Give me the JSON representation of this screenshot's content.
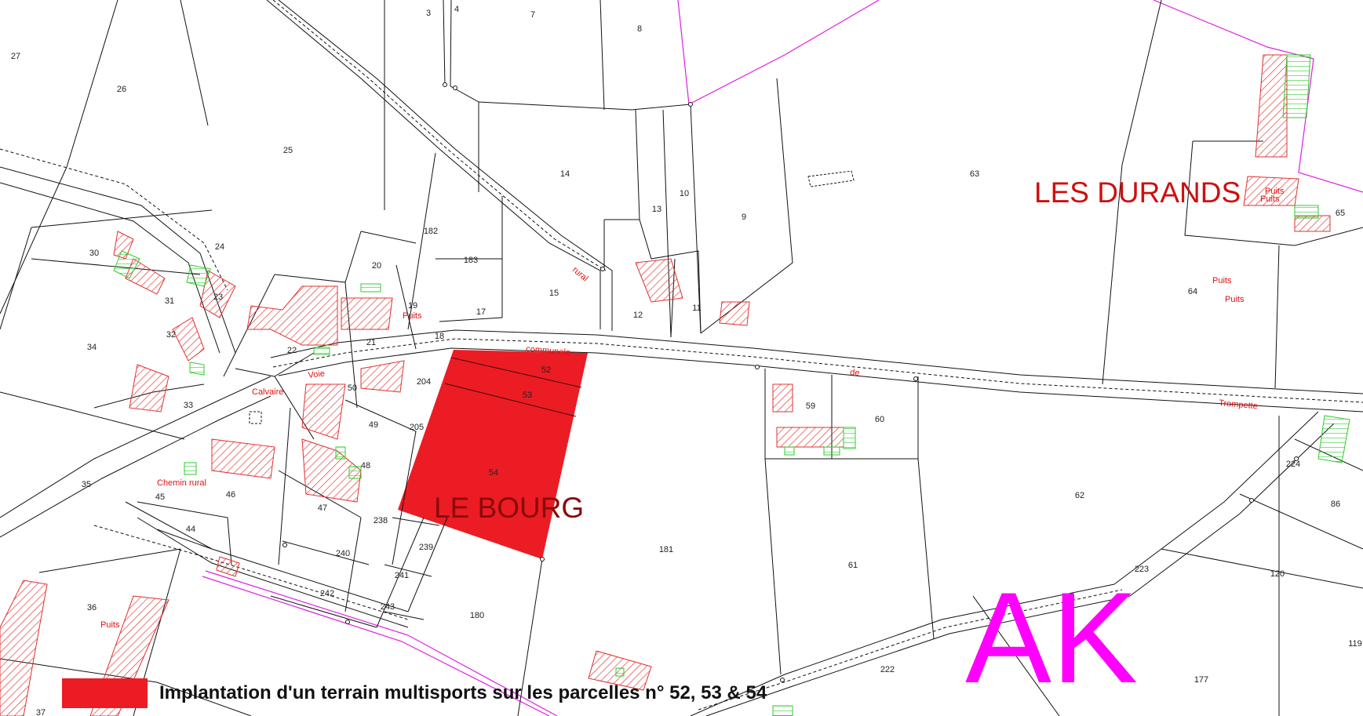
{
  "map": {
    "place_names": {
      "les_durands": "LES DURANDS",
      "le_bourg": "LE BOURG"
    },
    "section_label": "AK",
    "parcels": [
      "3",
      "4",
      "7",
      "8",
      "27",
      "26",
      "25",
      "14",
      "13",
      "10",
      "9",
      "63",
      "65",
      "30",
      "24",
      "20",
      "182",
      "183",
      "15",
      "12",
      "11",
      "64",
      "31",
      "23",
      "19",
      "17",
      "34",
      "32",
      "22",
      "21",
      "18",
      "33",
      "50",
      "204",
      "52",
      "53",
      "49",
      "205",
      "59",
      "60",
      "35",
      "48",
      "54",
      "224",
      "86",
      "46",
      "45",
      "47",
      "238",
      "62",
      "44",
      "239",
      "181",
      "240",
      "61",
      "120",
      "241",
      "223",
      "242",
      "243",
      "180",
      "36",
      "119",
      "222",
      "177",
      "37"
    ],
    "road_labels": {
      "voie": "Voie",
      "communale": "communale",
      "de": "de",
      "trompette": "Trompette",
      "chemin_rural": "Chemin rural",
      "calvaire": "Calvaire",
      "rural": "rural"
    },
    "puits": [
      "Puits",
      "Puits",
      "Puits",
      "Puits",
      "Puits",
      "Puits"
    ]
  },
  "legend": {
    "text": "Implantation d'un terrain multisports sur les parcelles n° 52, 53 & 54",
    "swatch_color": "#ec1c24"
  },
  "colors": {
    "highlight": "#ec1c24",
    "building_hatch": "#e03030",
    "annex_hatch": "#2ecc2e",
    "commune_border": "#e020e0",
    "place_name": "#cc1010",
    "section": "#ff00ff"
  }
}
